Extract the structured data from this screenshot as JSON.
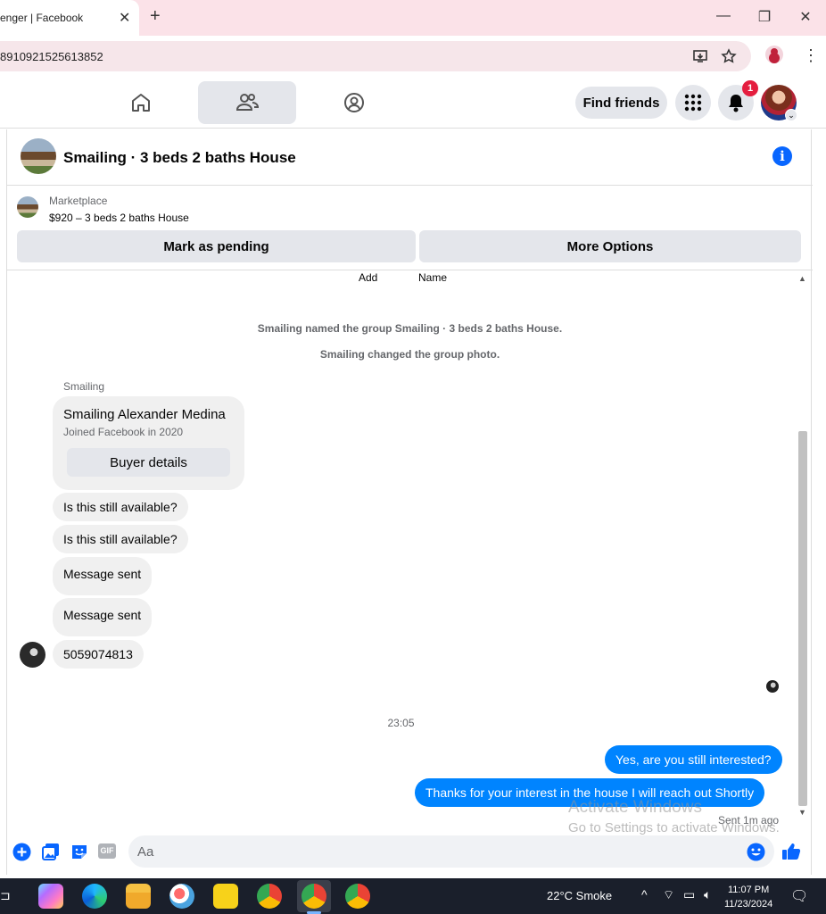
{
  "browser": {
    "tab_title": "enger | Facebook",
    "tab_close": "✕",
    "new_tab": "+",
    "url": "8910921525613852",
    "window_buttons": [
      "—",
      "❐",
      "✕"
    ]
  },
  "fb_nav": {
    "tabs": [
      {
        "name": "home",
        "icon": "home-icon"
      },
      {
        "name": "friends",
        "icon": "friends-icon",
        "active": true
      },
      {
        "name": "groups",
        "icon": "groups-icon"
      }
    ],
    "find_friends_label": "Find friends",
    "notification_count": "1",
    "avatar_caret": "⌄"
  },
  "chat": {
    "title": "Smailing · 3 beds 2 baths House",
    "marketplace": {
      "label": "Marketplace",
      "listing": "$920 – 3 beds 2 baths House",
      "mark_pending_label": "Mark as pending",
      "more_options_label": "More Options"
    },
    "top_labels": {
      "add": "Add",
      "name": "Name"
    },
    "system_messages": [
      "Smailing named the group Smailing · 3 beds 2 baths House.",
      "Smailing changed the group photo."
    ],
    "sender_name": "Smailing",
    "buyer_card": {
      "name": "Smailing Alexander Medina",
      "joined": "Joined Facebook in 2020",
      "button_label": "Buyer details"
    },
    "incoming": [
      "Is this still available?",
      "Is this still available?",
      "Message sent",
      "Message sent",
      "5059074813"
    ],
    "timestamp": "23:05",
    "outgoing": [
      "Yes, are you still interested?",
      "Thanks for your interest in the house I will reach out Shortly"
    ],
    "sent_status": "Sent 1m ago",
    "composer_placeholder": "Aa"
  },
  "watermark": {
    "line1": "Activate Windows",
    "line2": "Go to Settings to activate Windows."
  },
  "taskbar": {
    "weather": "22°C  Smoke",
    "time": "11:07 PM",
    "date": "11/23/2024",
    "tray_icons": [
      "^",
      "wifi-icon",
      "power-icon",
      "speaker-icon",
      "notification-icon"
    ]
  },
  "colors": {
    "messenger_blue": "#0084ff",
    "facebook_blue": "#0866ff",
    "badge_red": "#e41e3f"
  }
}
